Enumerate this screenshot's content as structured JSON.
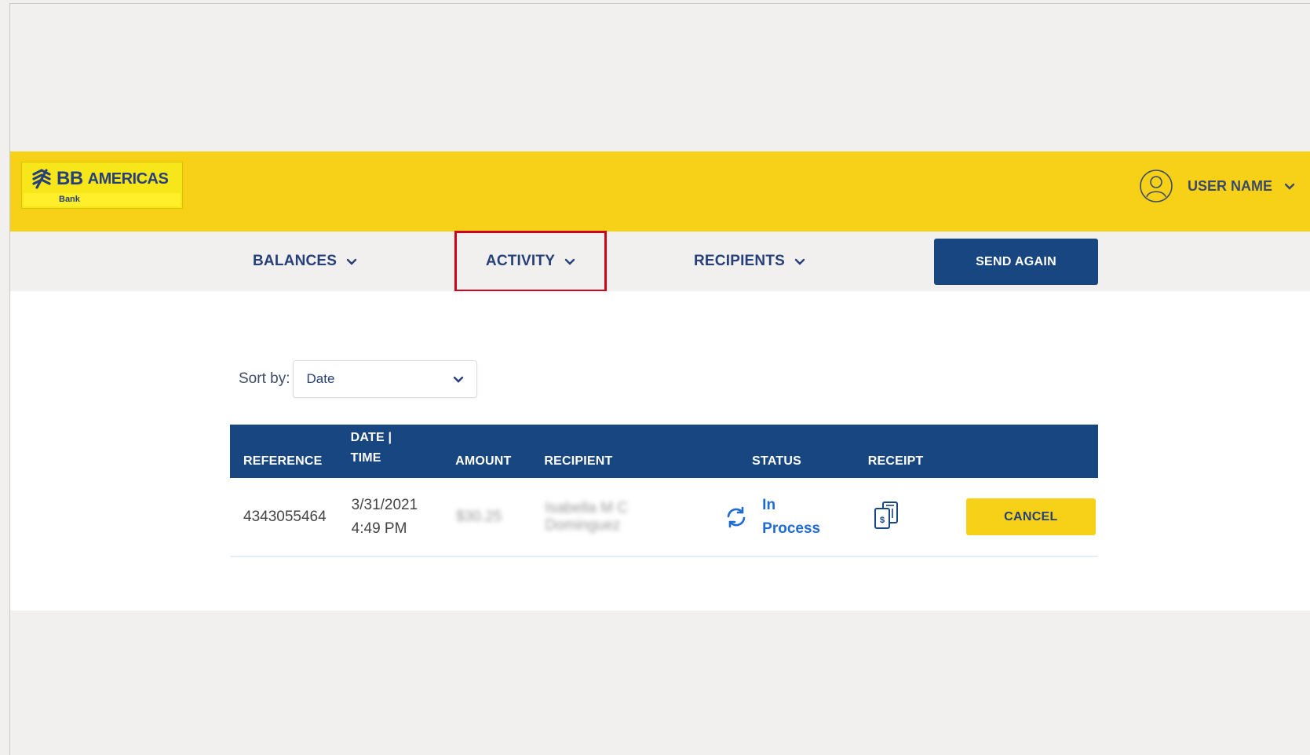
{
  "header": {
    "logo": {
      "brand_bb": "BB",
      "brand_americas": "AMERICAS",
      "brand_sub": "Bank"
    },
    "user_name": "USER NAME",
    "icons": {
      "avatar": "user-circle-icon",
      "dropdown": "chevron-down-icon"
    }
  },
  "nav": {
    "balances": "BALANCES",
    "activity": "ACTIVITY",
    "recipients": "RECIPIENTS",
    "send_again": "SEND AGAIN",
    "highlight_color": "#d0021b"
  },
  "sort": {
    "label": "Sort by:",
    "selected": "Date"
  },
  "table": {
    "headers": {
      "reference": "REFERENCE",
      "date_line1": "DATE |",
      "date_line2": "TIME",
      "amount": "AMOUNT",
      "recipient": "RECIPIENT",
      "status": "STATUS",
      "receipt": "RECEIPT"
    },
    "rows": [
      {
        "reference": "4343055464",
        "date": "3/31/2021",
        "time": "4:49 PM",
        "amount": "$30.25",
        "recipient_line1": "Isabella M C",
        "recipient_line2": "Dominguez",
        "status_line1": "In",
        "status_line2": "Process",
        "action": "CANCEL"
      }
    ]
  },
  "colors": {
    "brand_yellow": "#f7d117",
    "brand_blue": "#184680",
    "status_blue": "#1f6bd6"
  }
}
